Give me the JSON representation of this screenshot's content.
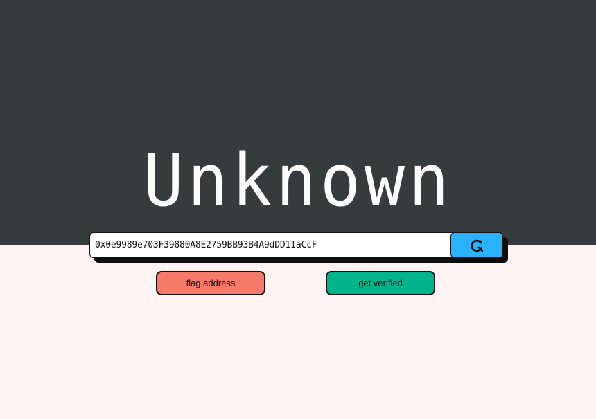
{
  "header": {
    "status_title": "Unknown"
  },
  "search": {
    "value": "0x0e9989e703F39880A8E2759BB93B4A9dDD11aCcF",
    "button_icon": "search-refresh-icon"
  },
  "actions": {
    "flag_label": "flag address",
    "verify_label": "get verified"
  },
  "colors": {
    "top_background": "#363b3e",
    "bottom_background": "#fff4f3",
    "search_button": "#2ab2ff",
    "flag_button": "#f67a6a",
    "verify_button": "#00b38a"
  }
}
